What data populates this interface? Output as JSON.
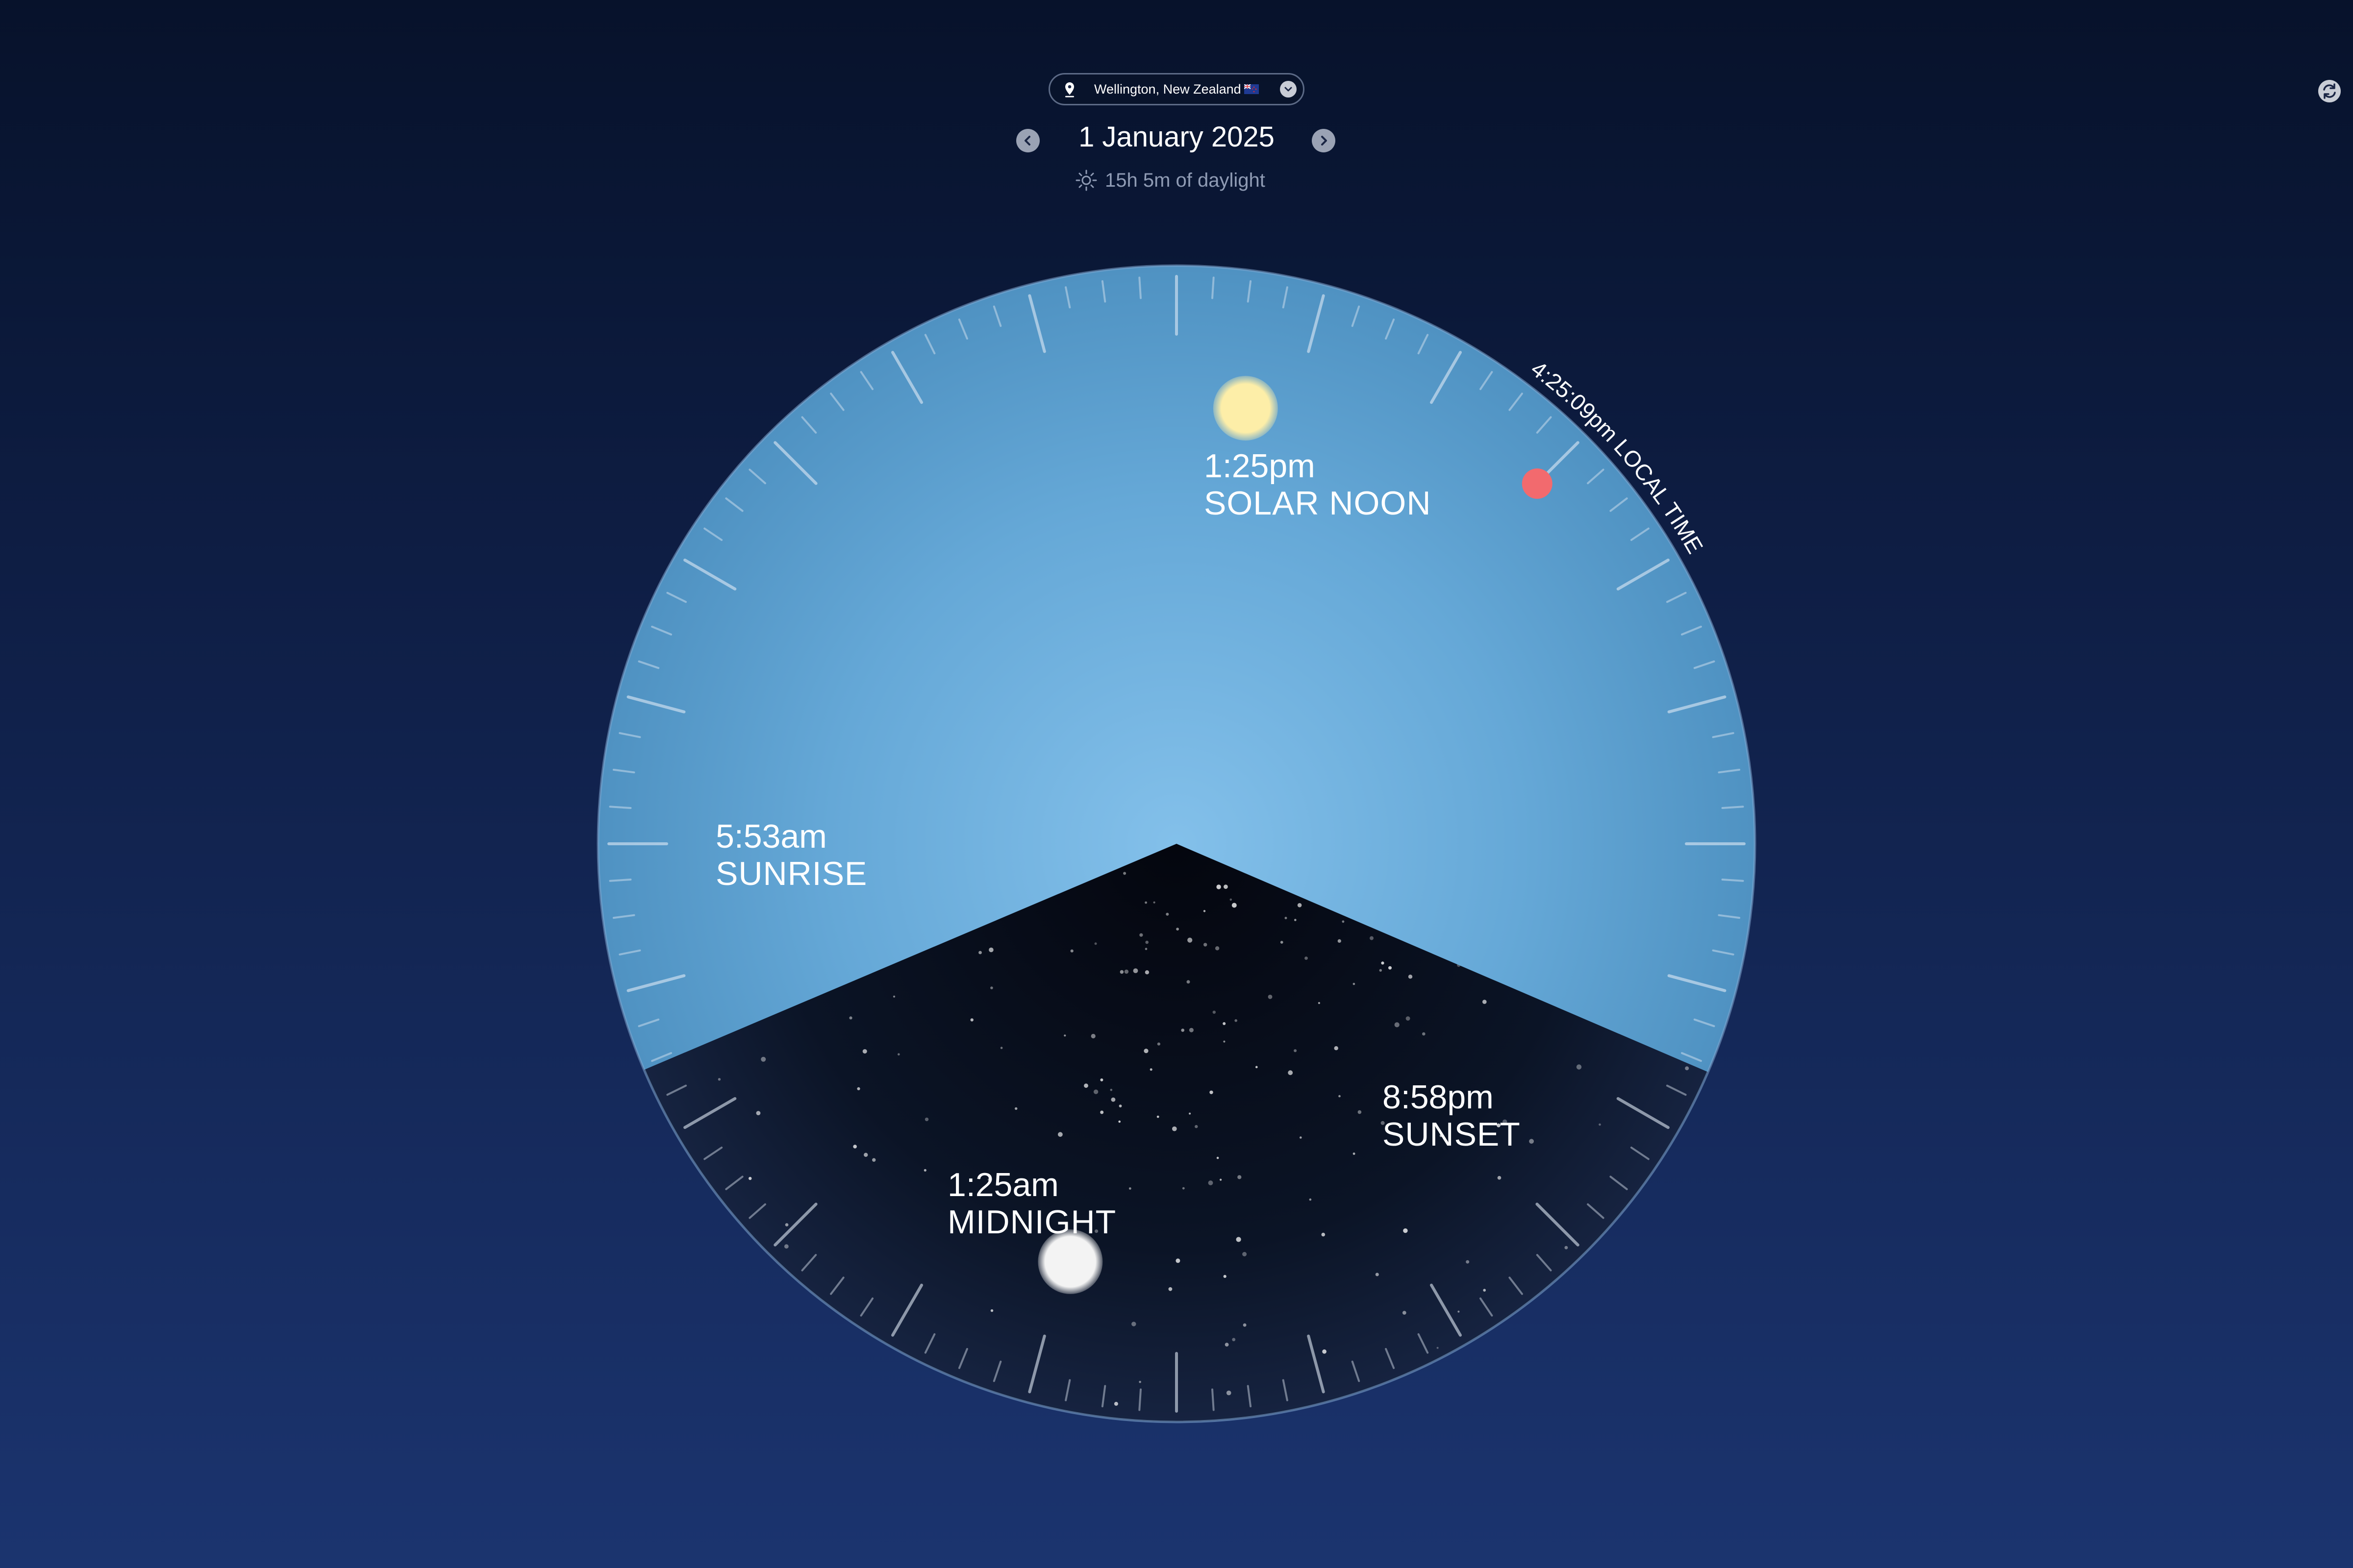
{
  "header": {
    "location": "Wellington, New Zealand",
    "date": "1 January 2025",
    "daylight": "15h 5m of daylight",
    "icons": {
      "location": "map-pin-icon",
      "flag": "new-zealand-flag-icon",
      "dropdown": "chevron-down-icon",
      "prev": "chevron-left-icon",
      "next": "chevron-right-icon",
      "daylight": "sun-icon",
      "refresh": "refresh-icon"
    }
  },
  "dial": {
    "current_time_label": "4:25:09pm LOCAL TIME",
    "current_time_hours": 16.419,
    "events": {
      "solar_noon": {
        "time": "1:25pm",
        "name": "SOLAR NOON",
        "hours": 13.417
      },
      "sunrise": {
        "time": "5:53am",
        "name": "SUNRISE",
        "hours": 5.883
      },
      "sunset": {
        "time": "8:58pm",
        "name": "SUNSET",
        "hours": 20.967
      },
      "midnight": {
        "time": "1:25am",
        "name": "MIDNIGHT",
        "hours": 1.417
      }
    }
  },
  "colors": {
    "day_sky": "#6fb0df",
    "night_sky": "#0a1020",
    "sun": "#fbeaa0",
    "moon": "#f2f2f2",
    "current_marker": "#f26a6e",
    "background_top": "#07122b",
    "background_bottom": "#1b346f"
  }
}
